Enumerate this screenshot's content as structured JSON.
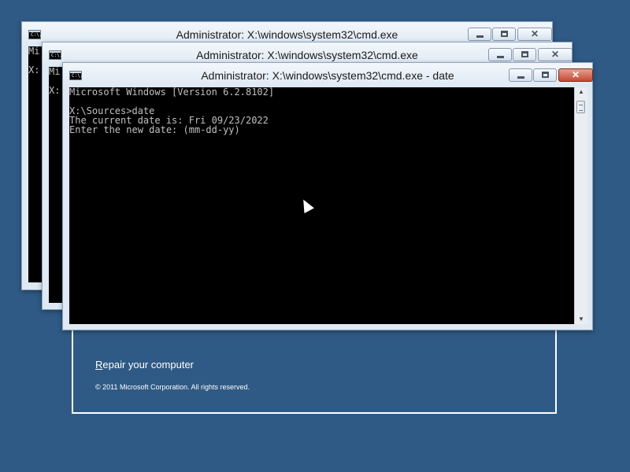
{
  "setup": {
    "repair_first_letter": "R",
    "repair_rest": "epair your computer",
    "copyright": "© 2011 Microsoft Corporation. All rights reserved."
  },
  "windows": [
    {
      "title": "Administrator: X:\\windows\\system32\\cmd.exe",
      "visible_text": [
        "Mi",
        "",
        "X:"
      ]
    },
    {
      "title": "Administrator: X:\\windows\\system32\\cmd.exe",
      "visible_text": [
        "Mi",
        "",
        "X:"
      ]
    },
    {
      "title": "Administrator: X:\\windows\\system32\\cmd.exe - date",
      "console_lines": [
        "Microsoft Windows [Version 6.2.8102]",
        "",
        "X:\\Sources>date",
        "The current date is: Fri 09/23/2022",
        "Enter the new date: (mm-dd-yy)"
      ]
    }
  ],
  "icon_label": "C:\\.",
  "colors": {
    "desktop": "#2f5a85",
    "console_bg": "#000000",
    "console_text": "#c0c0c0",
    "close_active": "#c44a33"
  }
}
